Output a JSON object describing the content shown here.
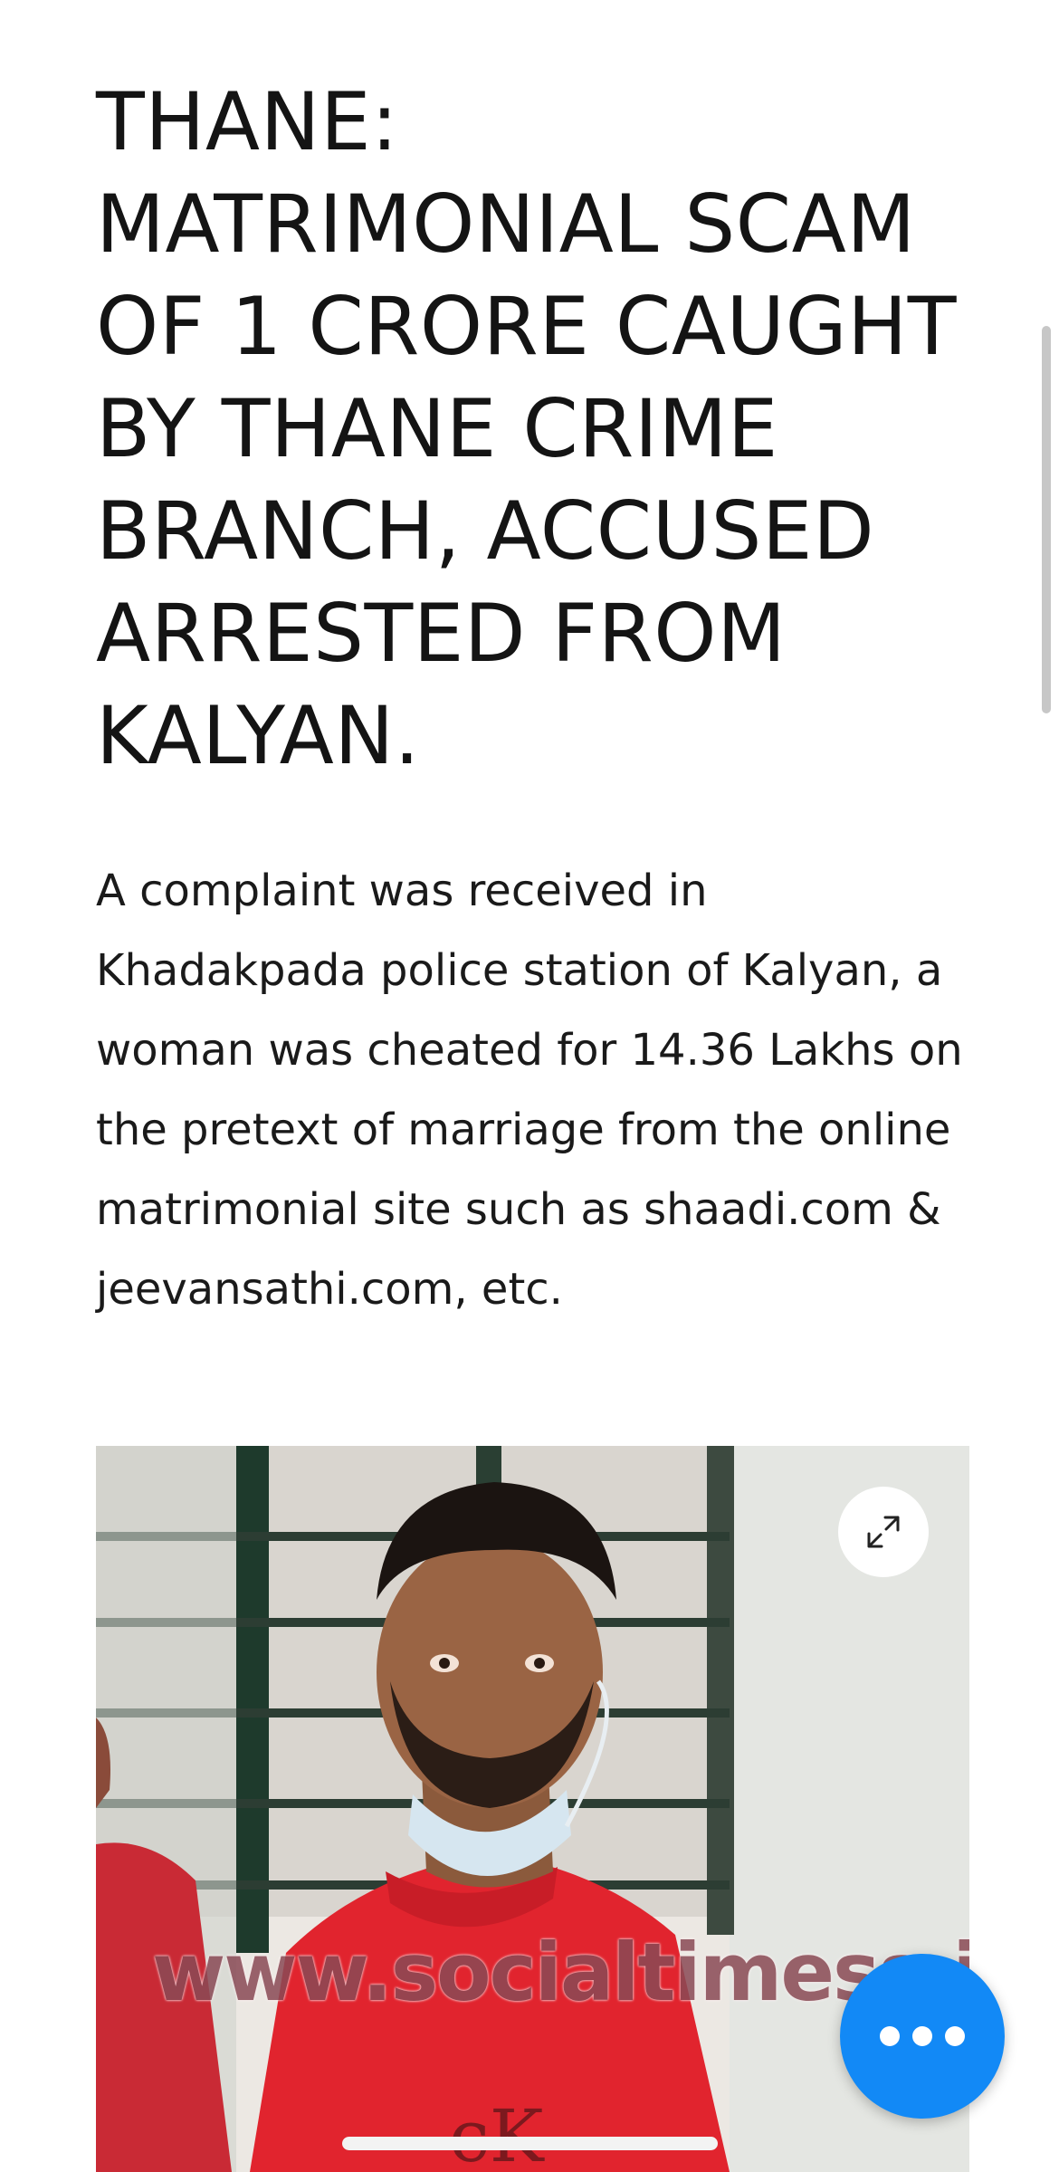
{
  "article": {
    "headline": "THANE: MATRIMONIAL SCAM OF 1 CRORE CAUGHT BY THANE CRIME BRANCH, ACCUSED ARRESTED FROM KALYAN.",
    "body": "A complaint was received in Khadakpada police station of Kalyan, a woman was cheated for 14.36 Lakhs on the pretext of marriage from the online matrimonial site such as shaadi.com & jeevansathi.com, etc.",
    "image": {
      "watermark": "www.socialtimess.in",
      "expand_icon": "expand-icon"
    }
  },
  "chat_button": {
    "icon": "more-dots-icon",
    "color": "#1289f6"
  },
  "colors": {
    "text": "#141414",
    "background": "#ffffff"
  }
}
